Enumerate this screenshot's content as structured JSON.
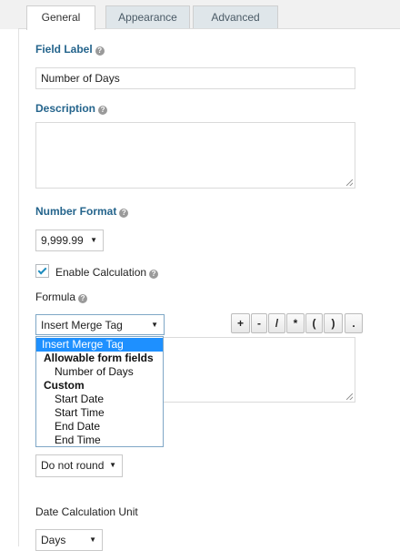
{
  "tabs": [
    {
      "label": "General",
      "active": true
    },
    {
      "label": "Appearance",
      "active": false
    },
    {
      "label": "Advanced",
      "active": false
    }
  ],
  "field_label": {
    "heading": "Field Label",
    "value": "Number of Days"
  },
  "description": {
    "heading": "Description",
    "value": ""
  },
  "number_format": {
    "heading": "Number Format",
    "selected": "9,999.99"
  },
  "enable_calculation": {
    "label": "Enable Calculation",
    "checked": true
  },
  "formula": {
    "heading": "Formula",
    "merge_tag_select": "Insert Merge Tag",
    "operators": [
      "+",
      "-",
      "/",
      "*",
      "(",
      ")",
      "."
    ],
    "dropdown": {
      "selected": "Insert Merge Tag",
      "group1": "Allowable form fields",
      "group1_items": [
        "Number of Days"
      ],
      "group2": "Custom",
      "group2_items": [
        "Start Date",
        "Start Time",
        "End Date",
        "End Time"
      ]
    }
  },
  "rounding": {
    "selected": "Do not round"
  },
  "date_unit": {
    "heading": "Date Calculation Unit",
    "selected": "Days"
  },
  "colors": {
    "heading": "#24648c",
    "accent": "#1e8cbe",
    "selection": "#1e90ff"
  },
  "icons": {
    "help": "question-circle-icon",
    "caret": "caret-down-icon",
    "check": "checkmark-icon"
  }
}
